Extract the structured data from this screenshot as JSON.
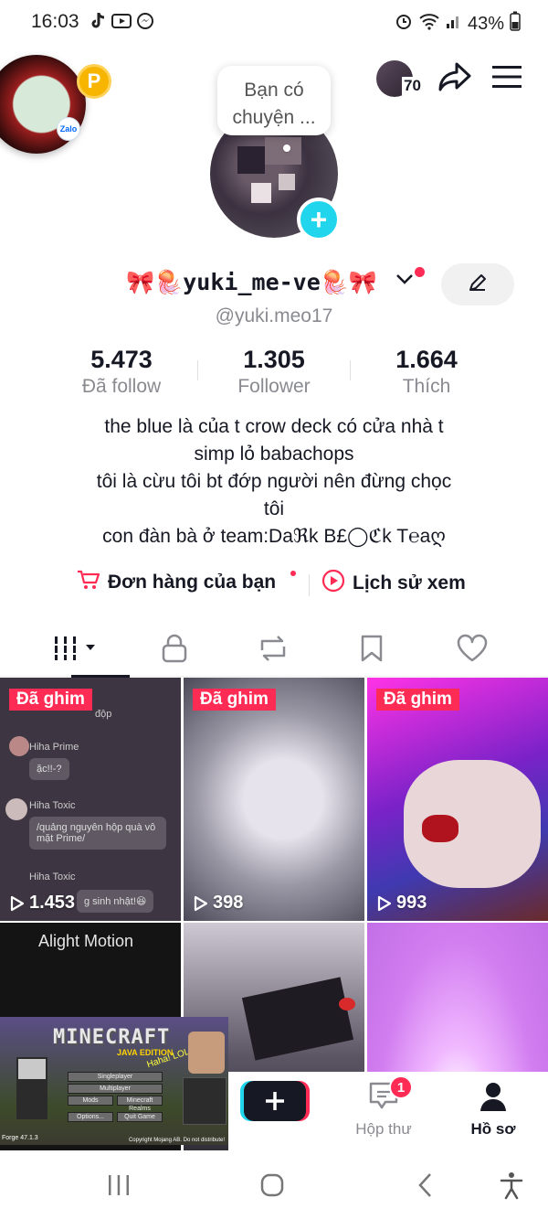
{
  "status_bar": {
    "time": "16:03",
    "battery": "43%"
  },
  "header": {
    "bubble_text": "Bạn có chuyện ...",
    "notif_count": "70",
    "p_badge": "P",
    "zalo": "Zalo"
  },
  "profile": {
    "display_name": "🎀🪼yuki_me-ve🪼🎀",
    "handle": "@yuki.meo17"
  },
  "stats": [
    {
      "value": "5.473",
      "label": "Đã follow"
    },
    {
      "value": "1.305",
      "label": "Follower"
    },
    {
      "value": "1.664",
      "label": "Thích"
    }
  ],
  "bio": [
    "the blue là của t crow deck có cửa nhà t",
    "simp lỏ babachops",
    "tôi là cừu tôi bt đớp người nên đừng chọc",
    "tôi",
    "con đàn bà ở team:Daℜk B£◯ℭk T℮aღ"
  ],
  "links": {
    "orders": "Đơn hàng của bạn",
    "history": "Lịch sử xem"
  },
  "videos": [
    {
      "pin": "Đã ghim",
      "views": "1.453"
    },
    {
      "pin": "Đã ghim",
      "views": "398"
    },
    {
      "pin": "Đã ghim",
      "views": "993"
    },
    {
      "title": "Alight Motion"
    },
    {},
    {}
  ],
  "chat_preview": {
    "top": "độp",
    "name1": "Hiha Prime",
    "msg1": "ặc!!-?",
    "name2": "Hiha Toxic",
    "msg2": "/quảng nguyên hộp quà vô mặt Prime/",
    "name3": "Hiha Toxic",
    "msg3": "g sinh nhật!😆"
  },
  "minecraft": {
    "title": "MINECRAFT",
    "edition": "JAVA EDITION",
    "splash": "Haha! LOL",
    "buttons": [
      "Singleplayer",
      "Multiplayer",
      "Mods",
      "Minecraft Realms",
      "Options...",
      "Quit Game"
    ],
    "footer_left": "Forge 47.1.3",
    "footer_right": "Copyright Mojang AB. Do not distribute!"
  },
  "bottom_nav": {
    "inbox_label": "Hộp thư",
    "inbox_badge": "1",
    "profile_label": "Hồ sơ"
  },
  "colors": {
    "accent_red": "#fe2c55",
    "accent_cyan": "#20d5ec",
    "text": "#161823",
    "muted": "#8a8b91"
  }
}
